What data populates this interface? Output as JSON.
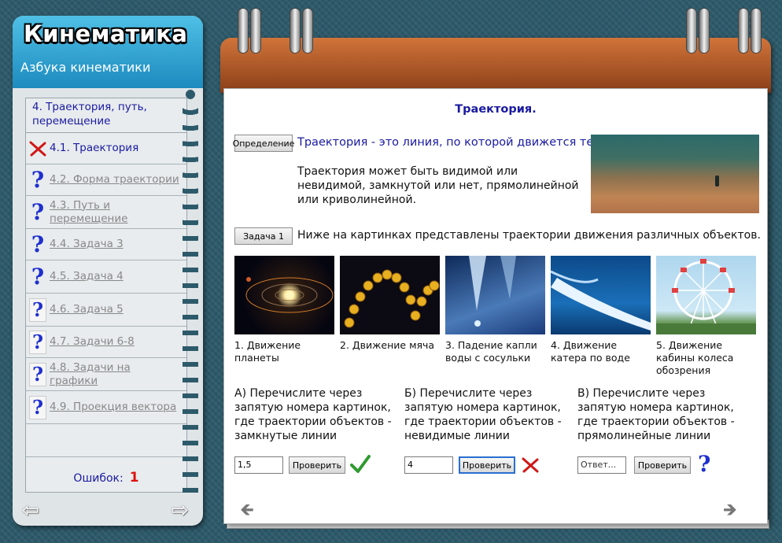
{
  "app": {
    "title": "Кинематика",
    "subtitle": "Азбука кинематики"
  },
  "sidebar": {
    "section": "4. Траектория, путь, перемещение",
    "items": [
      {
        "label": "4.1. Траектория",
        "status": "wrong"
      },
      {
        "label": "4.2. Форма траектории",
        "status": "unknown"
      },
      {
        "label": "4.3. Путь и перемещение",
        "status": "unknown"
      },
      {
        "label": "4.4. Задача 3",
        "status": "unknown"
      },
      {
        "label": "4.5. Задача 4",
        "status": "unknown"
      },
      {
        "label": "4.6. Задача 5",
        "status": "unknown"
      },
      {
        "label": "4.7. Задачи 6-8",
        "status": "unknown"
      },
      {
        "label": "4.8. Задачи на графики",
        "status": "unknown"
      },
      {
        "label": "4.9. Проекция вектора",
        "status": "unknown"
      }
    ],
    "errors_label": "Ошибок:",
    "errors_count": "1"
  },
  "page": {
    "title": "Траектория.",
    "definition_button": "Определение",
    "definition_text": "Траектория - это линия, по которой движется тело.",
    "definition_body": "Траектория может быть видимой или невидимой, замкнутой или нет, прямолинейной или криволинейной.",
    "task_button": "Задача 1",
    "task_text": "Ниже на картинках представлены траектории движения различных объектов.",
    "pictures": [
      {
        "caption": "1. Движение планеты"
      },
      {
        "caption": "2. Движение мяча"
      },
      {
        "caption": "3. Падение капли воды с сосульки"
      },
      {
        "caption": "4. Движение катера по воде"
      },
      {
        "caption": "5. Движение кабины колеса обозрения"
      }
    ],
    "questions": [
      {
        "text": "А) Перечислите через запятую номера картинок, где траектории объектов - замкнутые линии",
        "value": "1,5",
        "placeholder": "",
        "button": "Проверить",
        "result": "correct"
      },
      {
        "text": "Б) Перечислите через запятую номера картинок, где траектории объектов - невидимые линии",
        "value": "4",
        "placeholder": "",
        "button": "Проверить",
        "result": "wrong"
      },
      {
        "text": "В) Перечислите через запятую номера картинок, где траектории объектов - прямолинейные линии",
        "value": "",
        "placeholder": "Ответ...",
        "button": "Проверить",
        "result": "unknown"
      }
    ]
  },
  "colors": {
    "accent": "#1a1aa0",
    "error": "#e01010",
    "correct": "#2e9a2e",
    "header": "#2a9fd2"
  },
  "icons": {
    "wrong": "red-cross-icon",
    "correct": "green-check-icon",
    "unknown": "blue-question-icon"
  }
}
